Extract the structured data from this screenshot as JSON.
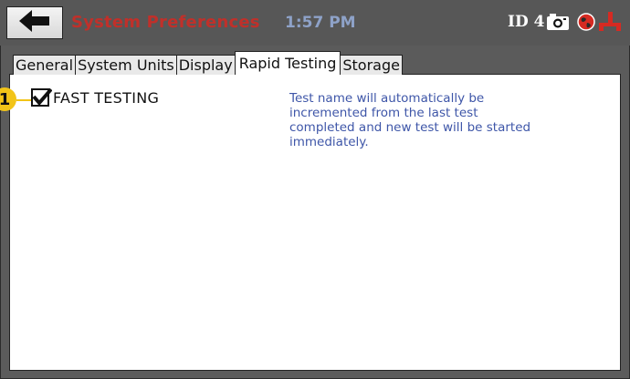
{
  "header": {
    "title": "System Preferences",
    "time": "1:57 PM",
    "id_label": "ID 4",
    "icons": [
      "back-arrow-icon",
      "camera-icon",
      "globe-icon",
      "plug-icon"
    ]
  },
  "tabs": [
    {
      "label": "General",
      "active": false
    },
    {
      "label": "System Units",
      "active": false
    },
    {
      "label": "Display",
      "active": false
    },
    {
      "label": "Rapid Testing",
      "active": true
    },
    {
      "label": "Storage",
      "active": false
    }
  ],
  "options": {
    "fast_testing": {
      "label": "FAST TESTING",
      "checked": true
    },
    "description": "Test name will automatically be incremented from the last test completed and new test will be started immediately."
  },
  "callout": {
    "number": "1"
  },
  "colors": {
    "title": "#c0302a",
    "time": "#8ea2c8",
    "description": "#3e56a8",
    "callout": "#f2c418",
    "background": "#5b5b5b"
  }
}
